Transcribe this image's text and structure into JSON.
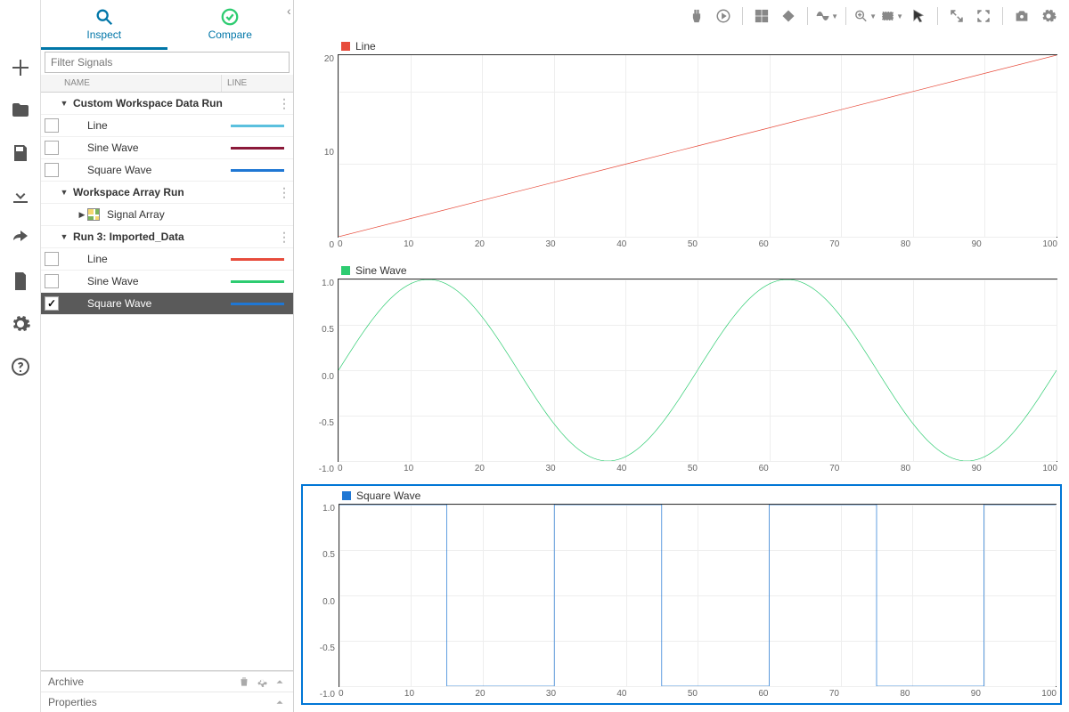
{
  "tabs": {
    "inspect": "Inspect",
    "compare": "Compare"
  },
  "filter": {
    "placeholder": "Filter Signals"
  },
  "columns": {
    "name": "NAME",
    "line": "LINE"
  },
  "tree": {
    "groups": [
      {
        "label": "Custom Workspace Data Run",
        "signals": [
          {
            "label": "Line",
            "color": "#5bc0de",
            "checked": false
          },
          {
            "label": "Sine Wave",
            "color": "#8b1a3a",
            "checked": false
          },
          {
            "label": "Square Wave",
            "color": "#1f77d4",
            "checked": false
          }
        ]
      },
      {
        "label": "Workspace Array Run",
        "children": [
          {
            "label": "Signal Array"
          }
        ]
      },
      {
        "label": "Run 3: Imported_Data",
        "signals": [
          {
            "label": "Line",
            "color": "#e74c3c",
            "checked": false
          },
          {
            "label": "Sine Wave",
            "color": "#2ecc71",
            "checked": false
          },
          {
            "label": "Square Wave",
            "color": "#1f77d4",
            "checked": true,
            "selected": true
          }
        ]
      }
    ]
  },
  "footer": {
    "archive": "Archive",
    "properties": "Properties"
  },
  "chart_data": [
    {
      "type": "line",
      "title": "Line",
      "color": "#e74c3c",
      "x": [
        0,
        10,
        20,
        30,
        40,
        50,
        60,
        70,
        80,
        90,
        100
      ],
      "y": [
        0,
        2.5,
        5,
        7.5,
        10,
        12.5,
        15,
        17.5,
        20,
        22.5,
        25
      ],
      "xlim": [
        0,
        100
      ],
      "ylim": [
        0,
        25
      ],
      "xticks": [
        0,
        10,
        20,
        30,
        40,
        50,
        60,
        70,
        80,
        90,
        100
      ],
      "yticks": [
        0,
        10,
        20
      ]
    },
    {
      "type": "line",
      "title": "Sine Wave",
      "color": "#2ecc71",
      "x_range": [
        0,
        100
      ],
      "period": 50,
      "amplitude": 1.0,
      "xlim": [
        0,
        100
      ],
      "ylim": [
        -1,
        1
      ],
      "xticks": [
        0,
        10,
        20,
        30,
        40,
        50,
        60,
        70,
        80,
        90,
        100
      ],
      "yticks": [
        -1.0,
        -0.5,
        0,
        0.5,
        1.0
      ]
    },
    {
      "type": "step",
      "title": "Square Wave",
      "color": "#1f77d4",
      "selected": true,
      "period": 30,
      "high": 1.0,
      "low": -1.0,
      "edges": [
        0,
        15,
        30,
        45,
        60,
        75,
        90,
        100
      ],
      "xlim": [
        0,
        100
      ],
      "ylim": [
        -1,
        1
      ],
      "xticks": [
        0,
        10,
        20,
        30,
        40,
        50,
        60,
        70,
        80,
        90,
        100
      ],
      "yticks": [
        -1.0,
        -0.5,
        0,
        0.5,
        1.0
      ]
    }
  ]
}
